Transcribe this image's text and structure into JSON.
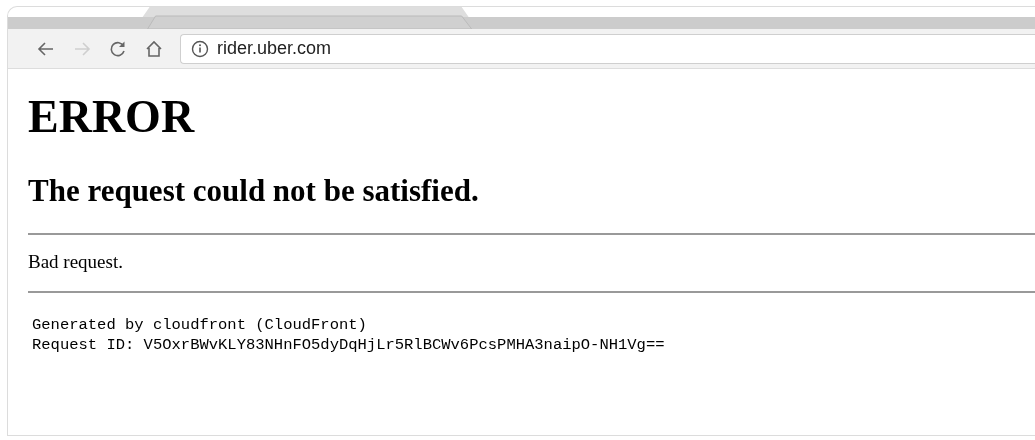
{
  "browser": {
    "address": "rider.uber.com",
    "forward_disabled": true
  },
  "page": {
    "title": "ERROR",
    "subtitle": "The request could not be satisfied.",
    "message": "Bad request.",
    "footer_lines": [
      "Generated by cloudfront (CloudFront)",
      "Request ID: V5OxrBWvKLY83NHnFO5dyDqHjLr5RlBCWv6PcsPMHA3naipO-NH1Vg=="
    ]
  }
}
